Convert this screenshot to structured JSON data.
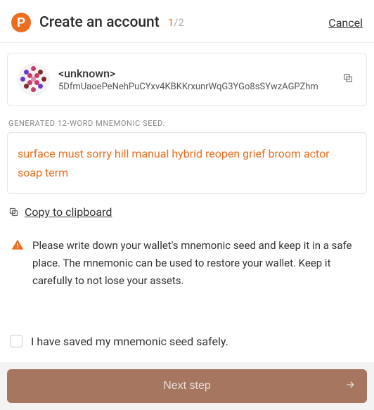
{
  "header": {
    "title": "Create an account",
    "step_current": "1",
    "step_total": "/2",
    "cancel": "Cancel"
  },
  "account": {
    "name": "<unknown>",
    "address": "5DfmUaoePeNehPuCYxv4KBKKrxunrWqG3YGo8sSYwzAGPZhm"
  },
  "seed_label": "GENERATED 12-WORD MNEMONIC SEED:",
  "seed": "surface must sorry hill manual hybrid reopen grief broom actor soap term",
  "copy_clipboard": "Copy to clipboard",
  "warning": "Please write down your wallet's mnemonic seed and keep it in a safe place. The mnemonic can be used to restore your wallet. Keep it carefully to not lose your assets.",
  "checkbox_label": "I have saved my mnemonic seed safely.",
  "next_button": "Next step"
}
